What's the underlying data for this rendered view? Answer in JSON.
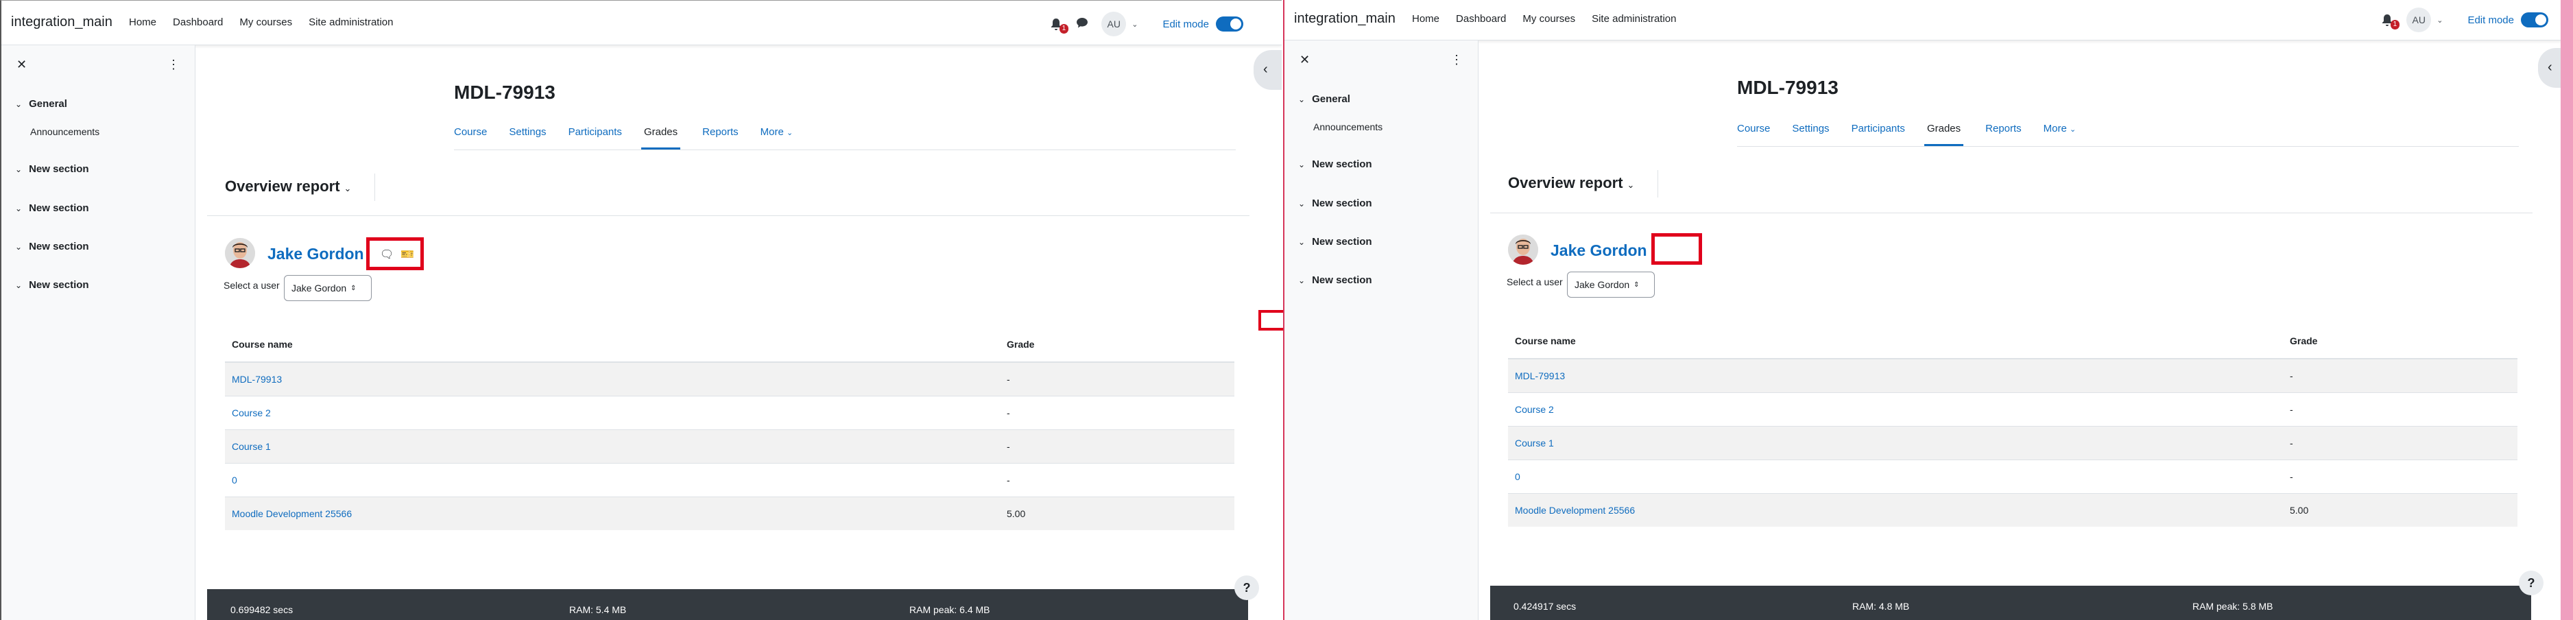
{
  "left": {
    "brand": "integration_main",
    "nav": [
      "Home",
      "Dashboard",
      "My courses",
      "Site administration"
    ],
    "notifications_count": "1",
    "user_initials": "AU",
    "edit_mode_label": "Edit mode",
    "drawer": {
      "sections": [
        "General",
        "New section",
        "New section",
        "New section",
        "New section"
      ],
      "general_item": "Announcements"
    },
    "course_title": "MDL-79913",
    "tabs": [
      "Course",
      "Settings",
      "Participants",
      "Grades",
      "Reports",
      "More"
    ],
    "report_title": "Overview report",
    "user_name": "Jake Gordon",
    "select_label": "Select a user",
    "select_value": "Jake Gordon",
    "table": {
      "headers": [
        "Course name",
        "Grade"
      ],
      "rows": [
        {
          "course": "MDL-79913",
          "grade": "-"
        },
        {
          "course": "Course 2",
          "grade": "-"
        },
        {
          "course": "Course 1",
          "grade": "-"
        },
        {
          "course": "0",
          "grade": "-"
        },
        {
          "course": "Moodle Development 25566",
          "grade": "5.00"
        }
      ]
    },
    "footer": {
      "time": "0.699482 secs",
      "ram": "RAM: 5.4 MB",
      "ram_peak": "RAM peak: 6.4 MB"
    },
    "help": "?"
  },
  "right": {
    "brand": "integration_main",
    "nav": [
      "Home",
      "Dashboard",
      "My courses",
      "Site administration"
    ],
    "notifications_count": "1",
    "user_initials": "AU",
    "edit_mode_label": "Edit mode",
    "drawer": {
      "sections": [
        "General",
        "New section",
        "New section",
        "New section",
        "New section"
      ],
      "general_item": "Announcements"
    },
    "course_title": "MDL-79913",
    "tabs": [
      "Course",
      "Settings",
      "Participants",
      "Grades",
      "Reports",
      "More"
    ],
    "report_title": "Overview report",
    "user_name": "Jake Gordon",
    "select_label": "Select a user",
    "select_value": "Jake Gordon",
    "table": {
      "headers": [
        "Course name",
        "Grade"
      ],
      "rows": [
        {
          "course": "MDL-79913",
          "grade": "-"
        },
        {
          "course": "Course 2",
          "grade": "-"
        },
        {
          "course": "Course 1",
          "grade": "-"
        },
        {
          "course": "0",
          "grade": "-"
        },
        {
          "course": "Moodle Development 25566",
          "grade": "5.00"
        }
      ]
    },
    "footer": {
      "time": "0.424917 secs",
      "ram": "RAM: 4.8 MB",
      "ram_peak": "RAM peak: 5.8 MB"
    },
    "help": "?"
  },
  "colors": {
    "link": "#0f6cbf",
    "highlight": "#e0001b",
    "footer": "#343a40"
  }
}
